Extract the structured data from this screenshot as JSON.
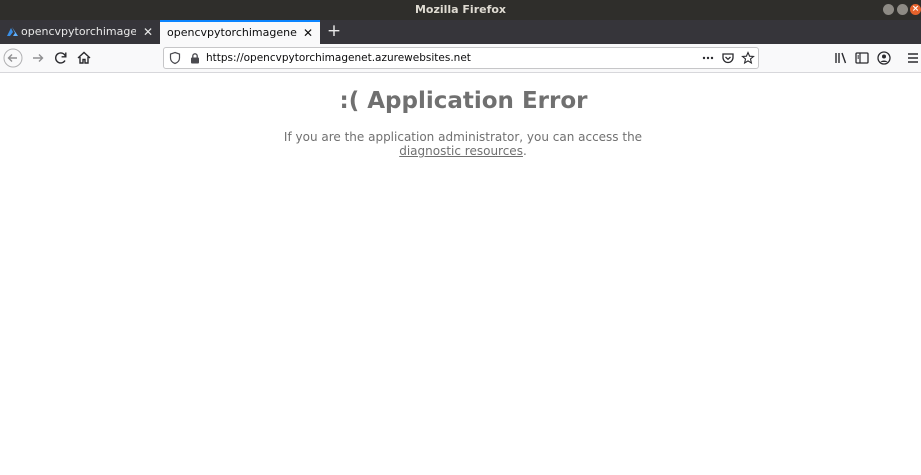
{
  "window": {
    "title": "Mozilla Firefox"
  },
  "tabs": [
    {
      "label": "opencvpytorchimagenet",
      "active": false
    },
    {
      "label": "opencvpytorchimagenet.azurewebsites.net",
      "active": true
    }
  ],
  "urlbar": {
    "url": "https://opencvpytorchimagenet.azurewebsites.net"
  },
  "page": {
    "headline": ":( Application Error",
    "message_prefix": "If you are the application administrator, you can access the ",
    "link_text": "diagnostic resources",
    "message_suffix": "."
  },
  "colors": {
    "accent": "#0a84ff",
    "text": "#707070"
  }
}
